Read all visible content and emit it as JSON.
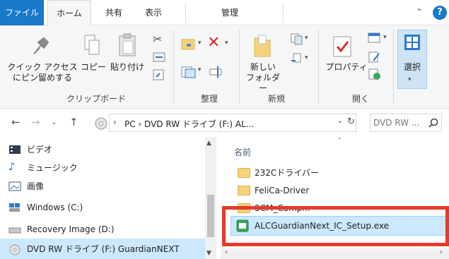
{
  "tabs": {
    "file": "ファイル",
    "home": "ホーム",
    "share": "共有",
    "view": "表示",
    "manage": "管理"
  },
  "ribbon": {
    "clipboard": {
      "pin_quick_access_line1": "クイック アクセス",
      "pin_quick_access_line2": "にピン留めする",
      "copy": "コピー",
      "paste": "貼り付け",
      "group": "クリップボード"
    },
    "organize": {
      "group": "整理"
    },
    "new": {
      "new_folder_line1": "新しい",
      "new_folder_line2": "フォルダー",
      "group": "新規"
    },
    "open": {
      "properties": "プロパティ",
      "group": "開く"
    },
    "select": {
      "select": "選択"
    }
  },
  "address": {
    "path": "PC  ›  DVD RW ドライブ (F:) AL...",
    "pc": "PC",
    "search_placeholder": "DVD RW ..."
  },
  "navpane": {
    "items": [
      "ビデオ",
      "ミュージック",
      "画像",
      "Windows (C:)",
      "Recovery Image (D:)",
      "DVD RW ドライブ (F:) GuardianNEXT"
    ]
  },
  "filelist": {
    "column_name": "名前",
    "items": [
      "232Cドライバー",
      "FeliCa-Driver",
      "SCM_Comp...",
      "ALCGuardianNext_IC_Setup.exe"
    ]
  },
  "colors": {
    "accent": "#1979ca",
    "selection": "#cce8ff",
    "highlight_box": "#e53a2b",
    "folder": "#f6d27a"
  }
}
